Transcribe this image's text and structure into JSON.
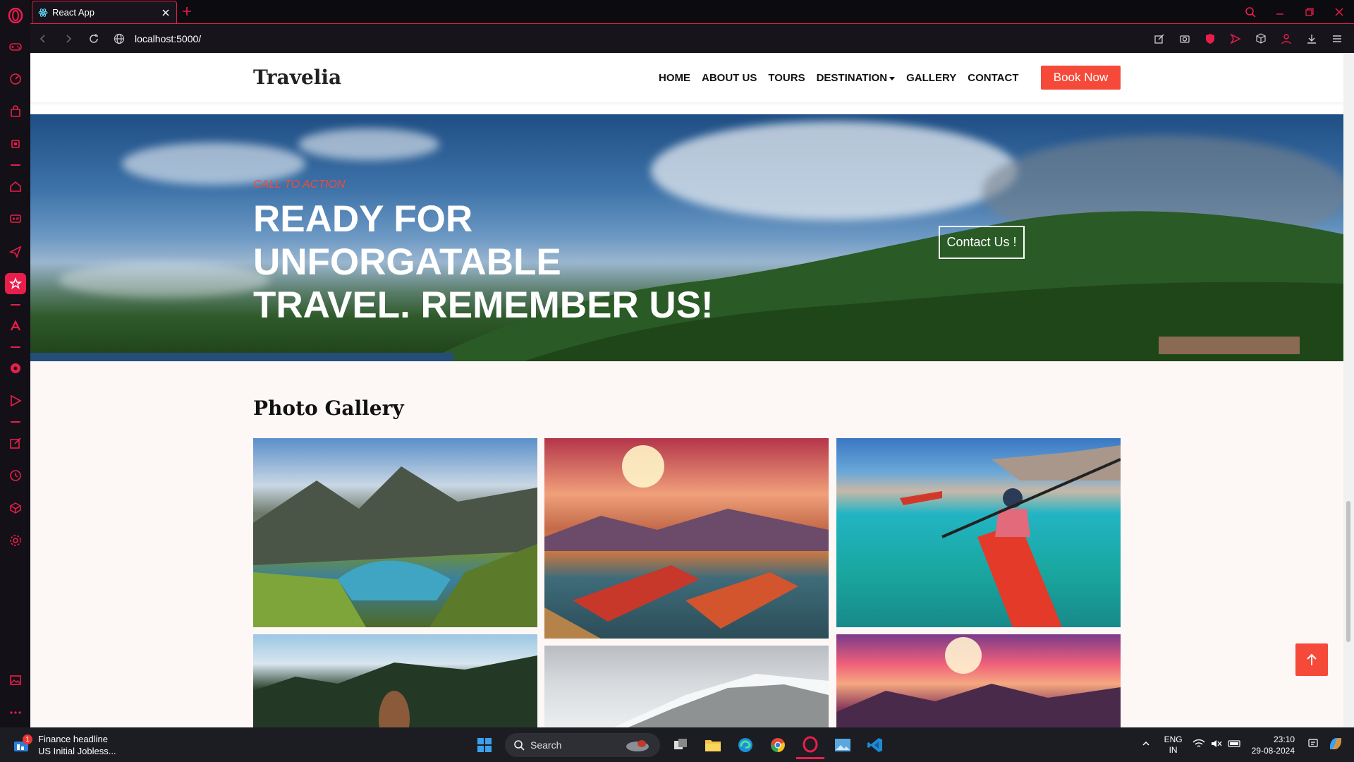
{
  "browser": {
    "tab_title": "React App",
    "url": "localhost:5000/"
  },
  "site": {
    "brand": "Travelia",
    "menu": [
      {
        "label": "HOME"
      },
      {
        "label": "ABOUT US"
      },
      {
        "label": "TOURS"
      },
      {
        "label": "DESTINATION"
      },
      {
        "label": "GALLERY"
      },
      {
        "label": "CONTACT"
      }
    ],
    "book_label": "Book Now"
  },
  "hero": {
    "subtitle": "CALL TO ACTION",
    "title_line1": "READY FOR UNFORGATABLE",
    "title_line2": "TRAVEL. REMEMBER US!",
    "cta_label": "Contact Us !"
  },
  "gallery": {
    "title": "Photo Gallery"
  },
  "taskbar": {
    "news_title": "Finance headline",
    "news_text": "US Initial Jobless...",
    "news_badge": "1",
    "search_placeholder": "Search",
    "lang_top": "ENG",
    "lang_bottom": "IN",
    "time": "23:10",
    "date": "29-08-2024"
  },
  "colors": {
    "accent": "#f54a3a",
    "opera_red": "#ea1e4b"
  }
}
